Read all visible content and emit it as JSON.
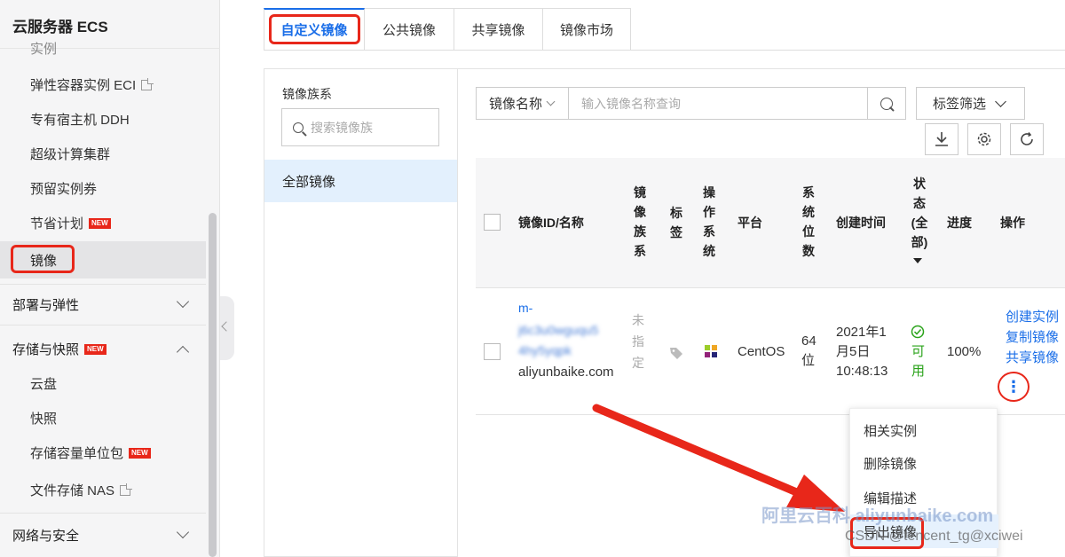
{
  "sidebar": {
    "title": "云服务器 ECS",
    "items": [
      {
        "label": "实例"
      },
      {
        "label": "弹性容器实例 ECI"
      },
      {
        "label": "专有宿主机 DDH"
      },
      {
        "label": "超级计算集群"
      },
      {
        "label": "预留实例券"
      },
      {
        "label": "节省计划",
        "badge": "NEW"
      },
      {
        "label": "镜像"
      }
    ],
    "groups": {
      "deploy": "部署与弹性",
      "storage": "存储与快照",
      "storage_badge": "NEW",
      "network": "网络与安全"
    },
    "storage_items": [
      {
        "label": "云盘"
      },
      {
        "label": "快照"
      },
      {
        "label": "存储容量单位包",
        "badge": "NEW"
      },
      {
        "label": "文件存储 NAS"
      }
    ]
  },
  "tabs": [
    "自定义镜像",
    "公共镜像",
    "共享镜像",
    "镜像市场"
  ],
  "left_panel": {
    "title": "镜像族系",
    "search_placeholder": "搜索镜像族",
    "all_images": "全部镜像"
  },
  "toolbar": {
    "select_label": "镜像名称",
    "input_placeholder": "输入镜像名称查询",
    "tag_filter": "标签筛选"
  },
  "table": {
    "headers": {
      "id_name": "镜像ID/名称",
      "family": "镜像族系",
      "tag": "标签",
      "os": "操作系统",
      "platform": "平台",
      "bits": "系统位数",
      "created": "创建时间",
      "status": "状态(全部)",
      "progress": "进度",
      "actions": "操作"
    },
    "row": {
      "id_line1": "m-",
      "id_line2": "j6c3u0wguqu5",
      "id_line3": "4hy5yqpk",
      "name": "aliyunbaike.com",
      "family": "未指定",
      "platform": "CentOS",
      "bits": "64位",
      "created_line1": "2021年1",
      "created_line2": "月5日",
      "created_line3": "10:48:13",
      "status": "可用",
      "progress": "100%",
      "actions": [
        "创建实例",
        "复制镜像",
        "共享镜像"
      ]
    }
  },
  "dropdown_menu": [
    "相关实例",
    "删除镜像",
    "编辑描述",
    "导出镜像"
  ],
  "watermark": "阿里云百科 aliyunbaike.com",
  "watermark2": "CSDN @tencent_tg@xciwei",
  "colors": {
    "accent": "#1a6ee8",
    "annotation": "#e8271a",
    "success": "#2aa31a"
  }
}
